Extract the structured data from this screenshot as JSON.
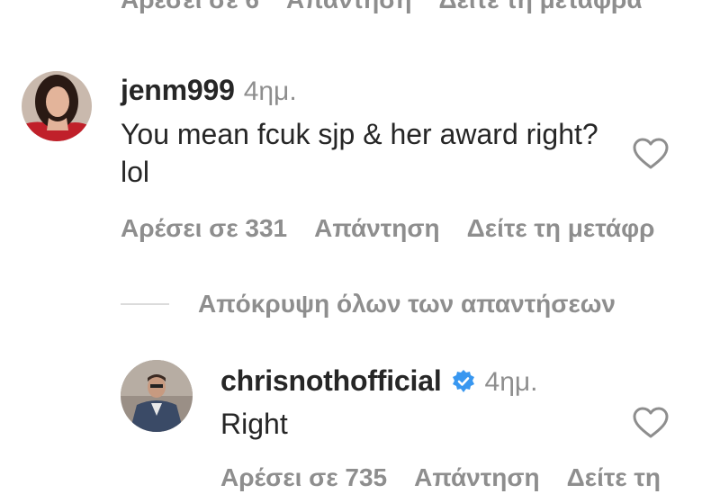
{
  "top_actions": {
    "likes": "Αρέσει σε 6",
    "reply": "Απάντηση",
    "translate": "Δείτε τη μεταφρα"
  },
  "comment1": {
    "username": "jenm999",
    "time": "4ημ.",
    "text": "You mean fcuk sjp & her award right? lol",
    "likes": "Αρέσει σε 331",
    "reply": "Απάντηση",
    "translate": "Δείτε τη μετάφρ"
  },
  "hide_replies": {
    "label": "Απόκρυψη όλων των απαντήσεων"
  },
  "reply1": {
    "username": "chrisnothofficial",
    "time": "4ημ.",
    "text": "Right",
    "likes": "Αρέσει σε 735",
    "reply": "Απάντηση",
    "translate": "Δείτε τη"
  },
  "icons": {
    "heart": "heart-outline-icon",
    "verified": "verified-badge-icon"
  },
  "colors": {
    "text": "#262626",
    "secondary": "#8e8e8e",
    "verified": "#3897f0",
    "divider": "#dbdbdb"
  }
}
